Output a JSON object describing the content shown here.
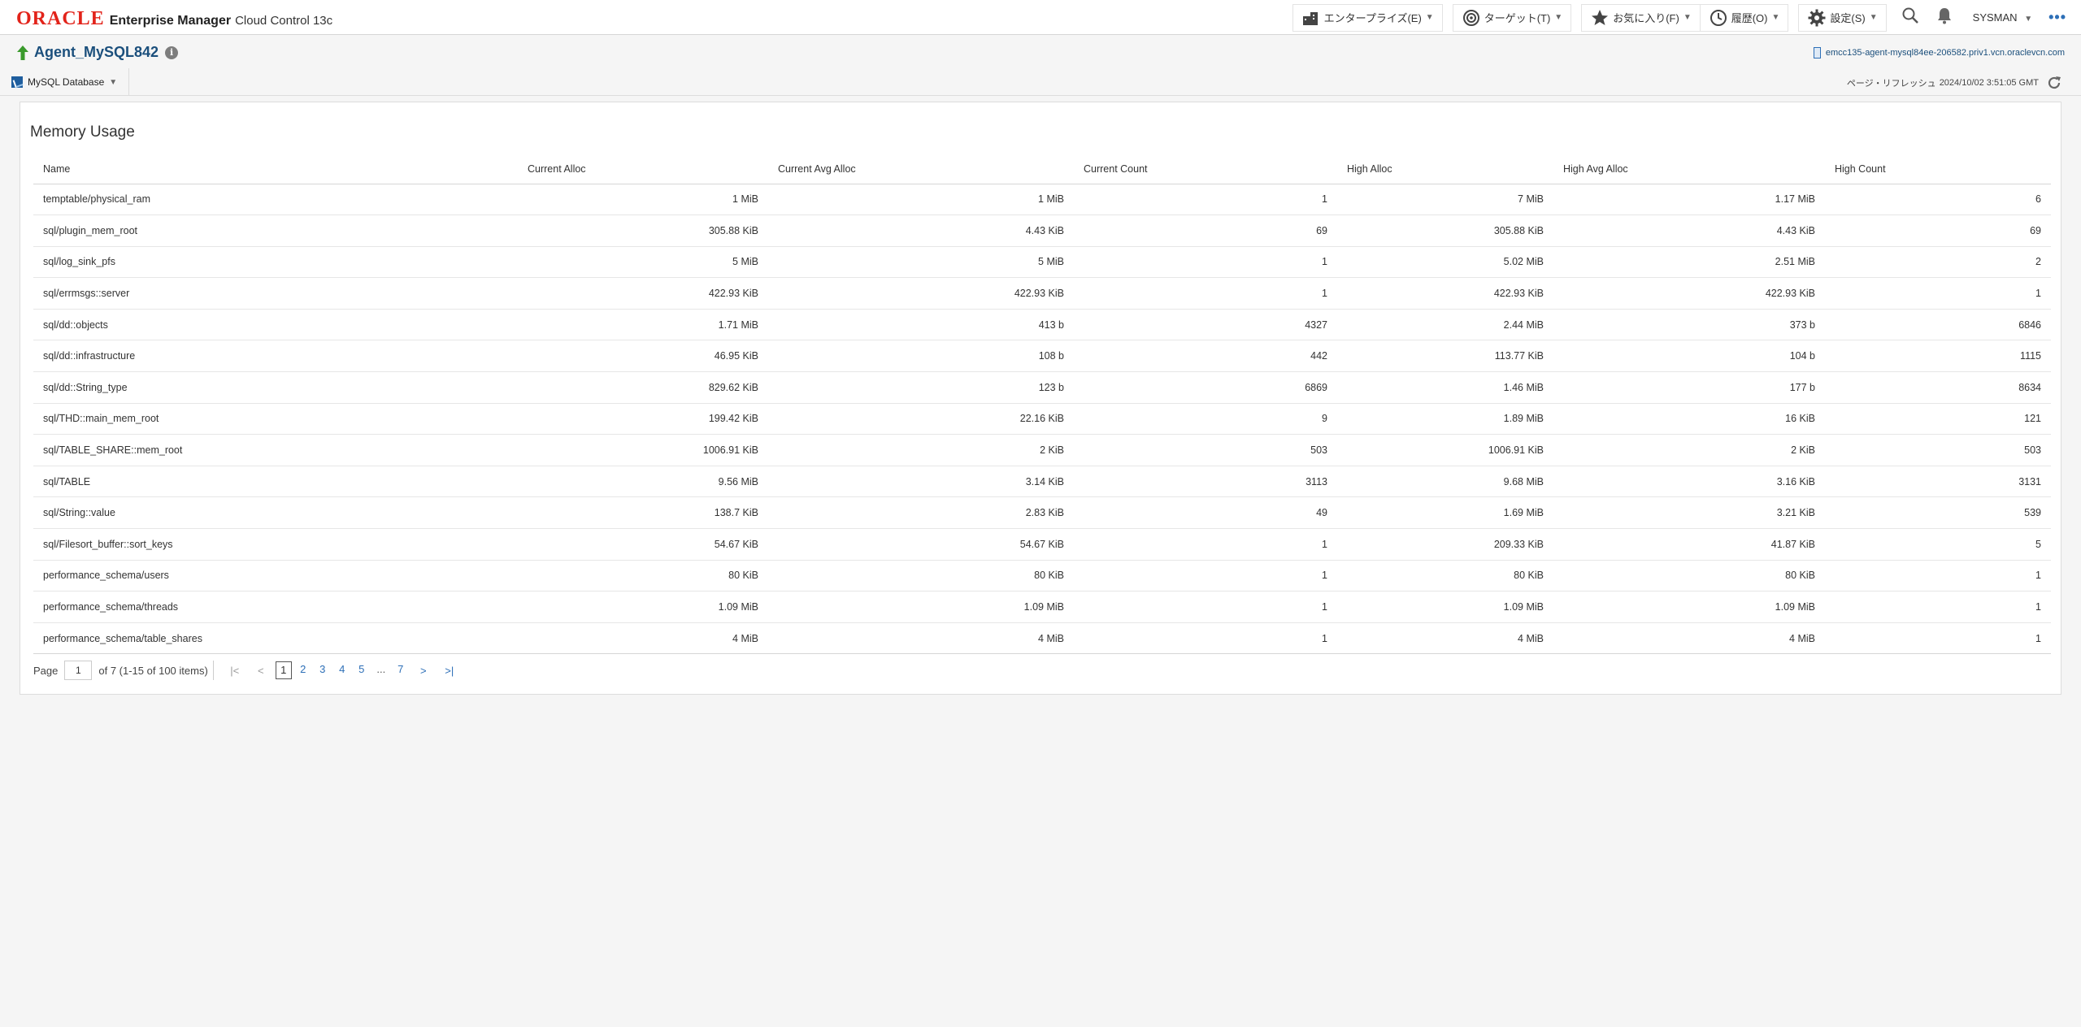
{
  "brand": {
    "oracle": "ORACLE",
    "product": "Enterprise Manager",
    "edition": "Cloud Control 13c"
  },
  "topmenu": {
    "enterprise": "エンタープライズ(E)",
    "targets": "ターゲット(T)",
    "favorites": "お気に入り(F)",
    "history": "履歴(O)",
    "setup": "設定(S)",
    "user": "SYSMAN",
    "more": "•••"
  },
  "target": {
    "name": "Agent_MySQL842",
    "host": "emcc135-agent-mysql84ee-206582.priv1.vcn.oraclevcn.com"
  },
  "subbar": {
    "menu": "MySQL Database",
    "refresh_label": "ページ・リフレッシュ",
    "refresh_time": "2024/10/02 3:51:05 GMT"
  },
  "panel": {
    "title": "Memory Usage"
  },
  "table": {
    "columns": [
      "Name",
      "Current Alloc",
      "Current Avg Alloc",
      "Current Count",
      "High Alloc",
      "High Avg Alloc",
      "High Count"
    ],
    "rows": [
      [
        "temptable/physical_ram",
        "1 MiB",
        "1 MiB",
        "1",
        "7 MiB",
        "1.17 MiB",
        "6"
      ],
      [
        "sql/plugin_mem_root",
        "305.88 KiB",
        "4.43 KiB",
        "69",
        "305.88 KiB",
        "4.43 KiB",
        "69"
      ],
      [
        "sql/log_sink_pfs",
        "5 MiB",
        "5 MiB",
        "1",
        "5.02 MiB",
        "2.51 MiB",
        "2"
      ],
      [
        "sql/errmsgs::server",
        "422.93 KiB",
        "422.93 KiB",
        "1",
        "422.93 KiB",
        "422.93 KiB",
        "1"
      ],
      [
        "sql/dd::objects",
        "1.71 MiB",
        "413 b",
        "4327",
        "2.44 MiB",
        "373 b",
        "6846"
      ],
      [
        "sql/dd::infrastructure",
        "46.95 KiB",
        "108 b",
        "442",
        "113.77 KiB",
        "104 b",
        "1115"
      ],
      [
        "sql/dd::String_type",
        "829.62 KiB",
        "123 b",
        "6869",
        "1.46 MiB",
        "177 b",
        "8634"
      ],
      [
        "sql/THD::main_mem_root",
        "199.42 KiB",
        "22.16 KiB",
        "9",
        "1.89 MiB",
        "16 KiB",
        "121"
      ],
      [
        "sql/TABLE_SHARE::mem_root",
        "1006.91 KiB",
        "2 KiB",
        "503",
        "1006.91 KiB",
        "2 KiB",
        "503"
      ],
      [
        "sql/TABLE",
        "9.56 MiB",
        "3.14 KiB",
        "3113",
        "9.68 MiB",
        "3.16 KiB",
        "3131"
      ],
      [
        "sql/String::value",
        "138.7 KiB",
        "2.83 KiB",
        "49",
        "1.69 MiB",
        "3.21 KiB",
        "539"
      ],
      [
        "sql/Filesort_buffer::sort_keys",
        "54.67 KiB",
        "54.67 KiB",
        "1",
        "209.33 KiB",
        "41.87 KiB",
        "5"
      ],
      [
        "performance_schema/users",
        "80 KiB",
        "80 KiB",
        "1",
        "80 KiB",
        "80 KiB",
        "1"
      ],
      [
        "performance_schema/threads",
        "1.09 MiB",
        "1.09 MiB",
        "1",
        "1.09 MiB",
        "1.09 MiB",
        "1"
      ],
      [
        "performance_schema/table_shares",
        "4 MiB",
        "4 MiB",
        "1",
        "4 MiB",
        "4 MiB",
        "1"
      ]
    ]
  },
  "pager": {
    "label": "Page",
    "current": "1",
    "summary": "of 7 (1-15 of 100 items)",
    "pages": [
      "1",
      "2",
      "3",
      "4",
      "5",
      "...",
      "7"
    ],
    "first": "|<",
    "prev": "<",
    "next": ">",
    "last": ">|"
  },
  "colors": {
    "oracle_red": "#e2231a",
    "link_blue": "#2d6fb7",
    "up_green": "#3a9a2c"
  }
}
